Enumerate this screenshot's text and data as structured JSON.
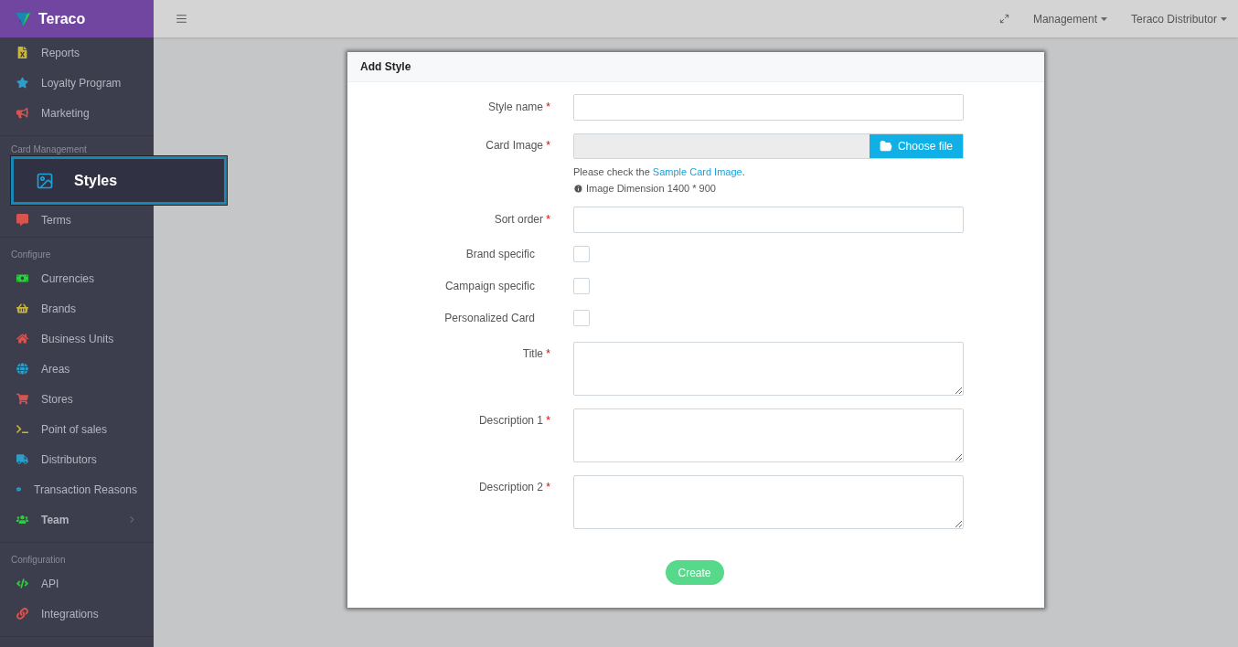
{
  "brand": {
    "name": "Teraco"
  },
  "sidebar": {
    "sections": [
      {
        "items": [
          {
            "label": "Reports",
            "kind": "link",
            "color": "#c9b53a"
          },
          {
            "label": "Loyalty Program",
            "kind": "link",
            "color": "#2a9fc9"
          },
          {
            "label": "Marketing",
            "kind": "link",
            "color": "#d9534f"
          }
        ]
      },
      {
        "label": "Card Management",
        "highlight": {
          "label": "Styles"
        },
        "items": [
          {
            "label": "Terms",
            "kind": "link",
            "color": "#d9534f"
          }
        ]
      },
      {
        "label": "Configure",
        "items": [
          {
            "label": "Currencies",
            "kind": "link",
            "color": "#2ecc40"
          },
          {
            "label": "Brands",
            "kind": "link",
            "color": "#c9b53a"
          },
          {
            "label": "Business Units",
            "kind": "link",
            "color": "#d9534f"
          },
          {
            "label": "Areas",
            "kind": "link",
            "color": "#2a9fc9"
          },
          {
            "label": "Stores",
            "kind": "link",
            "color": "#d9534f"
          },
          {
            "label": "Point of sales",
            "kind": "link",
            "color": "#c9b53a"
          },
          {
            "label": "Distributors",
            "kind": "link",
            "color": "#2a9fc9"
          },
          {
            "label": "Transaction Reasons",
            "kind": "link",
            "color": "#2a9fc9"
          },
          {
            "label": "Team",
            "kind": "group",
            "expanded": false,
            "color": "#2ecc40"
          }
        ]
      },
      {
        "label": "Configuration",
        "items": [
          {
            "label": "API",
            "kind": "link",
            "color": "#2ecc40"
          },
          {
            "label": "Integrations",
            "kind": "link",
            "color": "#d9534f"
          }
        ]
      }
    ]
  },
  "topbar": {
    "menus": [
      "Management",
      "Teraco Distributor"
    ]
  },
  "form": {
    "title": "Add Style",
    "fields": [
      {
        "kind": "text",
        "label": "Style name",
        "required_mark": "*"
      },
      {
        "kind": "file",
        "label": "Card Image",
        "required_mark": "*",
        "button": "Choose file",
        "hint_before": "Please check the ",
        "hint_link": "Sample Card Image",
        "hint_after": ".",
        "note": "Image Dimension 1400 * 900"
      },
      {
        "kind": "text",
        "label": "Sort order",
        "required_mark": "*"
      },
      {
        "kind": "checkbox",
        "label": "Brand specific",
        "checked": false
      },
      {
        "kind": "checkbox",
        "label": "Campaign specific",
        "checked": false
      },
      {
        "kind": "checkbox",
        "label": "Personalized Card",
        "checked": false
      },
      {
        "kind": "textarea",
        "label": "Title",
        "required_mark": "*"
      },
      {
        "kind": "textarea",
        "label": "Description 1",
        "required_mark": "*"
      },
      {
        "kind": "textarea",
        "label": "Description 2",
        "required_mark": "*"
      }
    ],
    "submit": "Create"
  }
}
